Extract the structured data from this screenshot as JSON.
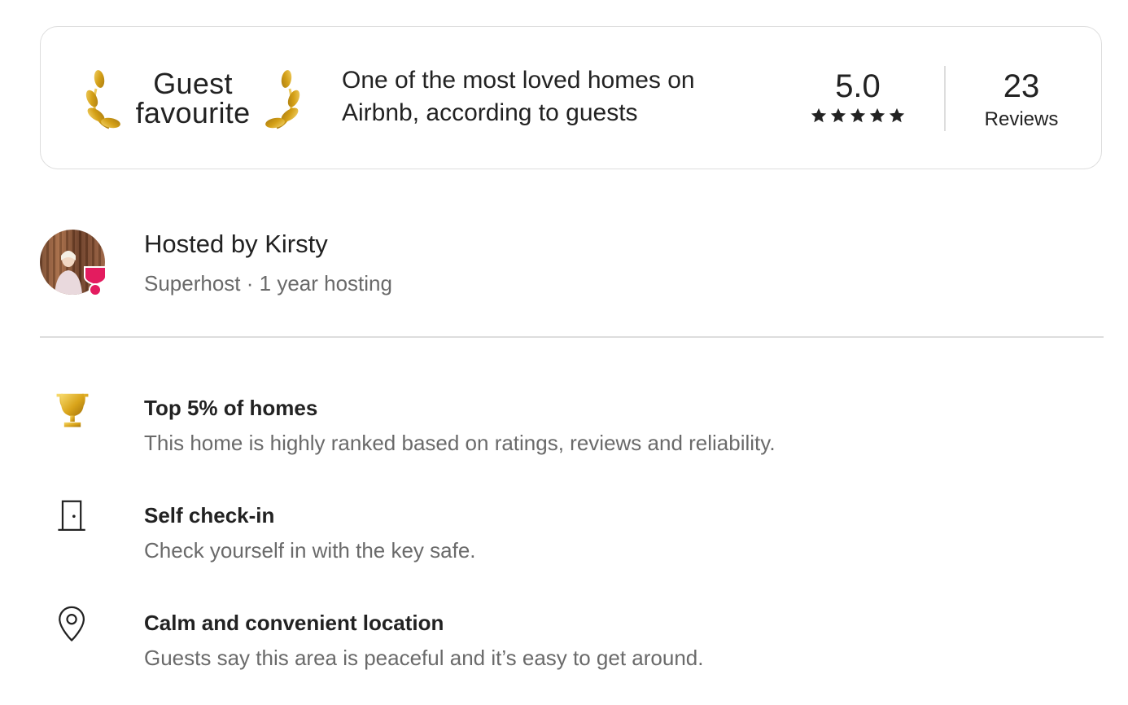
{
  "guest_favourite": {
    "badge_line1": "Guest",
    "badge_line2": "favourite",
    "description_line1": "One of the most loved homes on",
    "description_line2": "Airbnb, according to guests",
    "rating": "5.0",
    "stars": 5,
    "reviews_count": "23",
    "reviews_label": "Reviews"
  },
  "host": {
    "name": "Hosted by Kirsty",
    "subtitle": "Superhost · 1 year hosting",
    "badge_color": "#E31C5F"
  },
  "highlights": [
    {
      "icon": "trophy-icon",
      "title": "Top 5% of homes",
      "description": "This home is highly ranked based on ratings, reviews and reliability."
    },
    {
      "icon": "door-icon",
      "title": "Self check-in",
      "description": "Check yourself in with the key safe."
    },
    {
      "icon": "location-pin-icon",
      "title": "Calm and convenient location",
      "description": "Guests say this area is peaceful and it’s easy to get around."
    }
  ],
  "colors": {
    "text_primary": "#222222",
    "text_secondary": "#6A6A6A",
    "border": "#DDDDDD",
    "gold": "#D4A017",
    "brand": "#E31C5F"
  }
}
